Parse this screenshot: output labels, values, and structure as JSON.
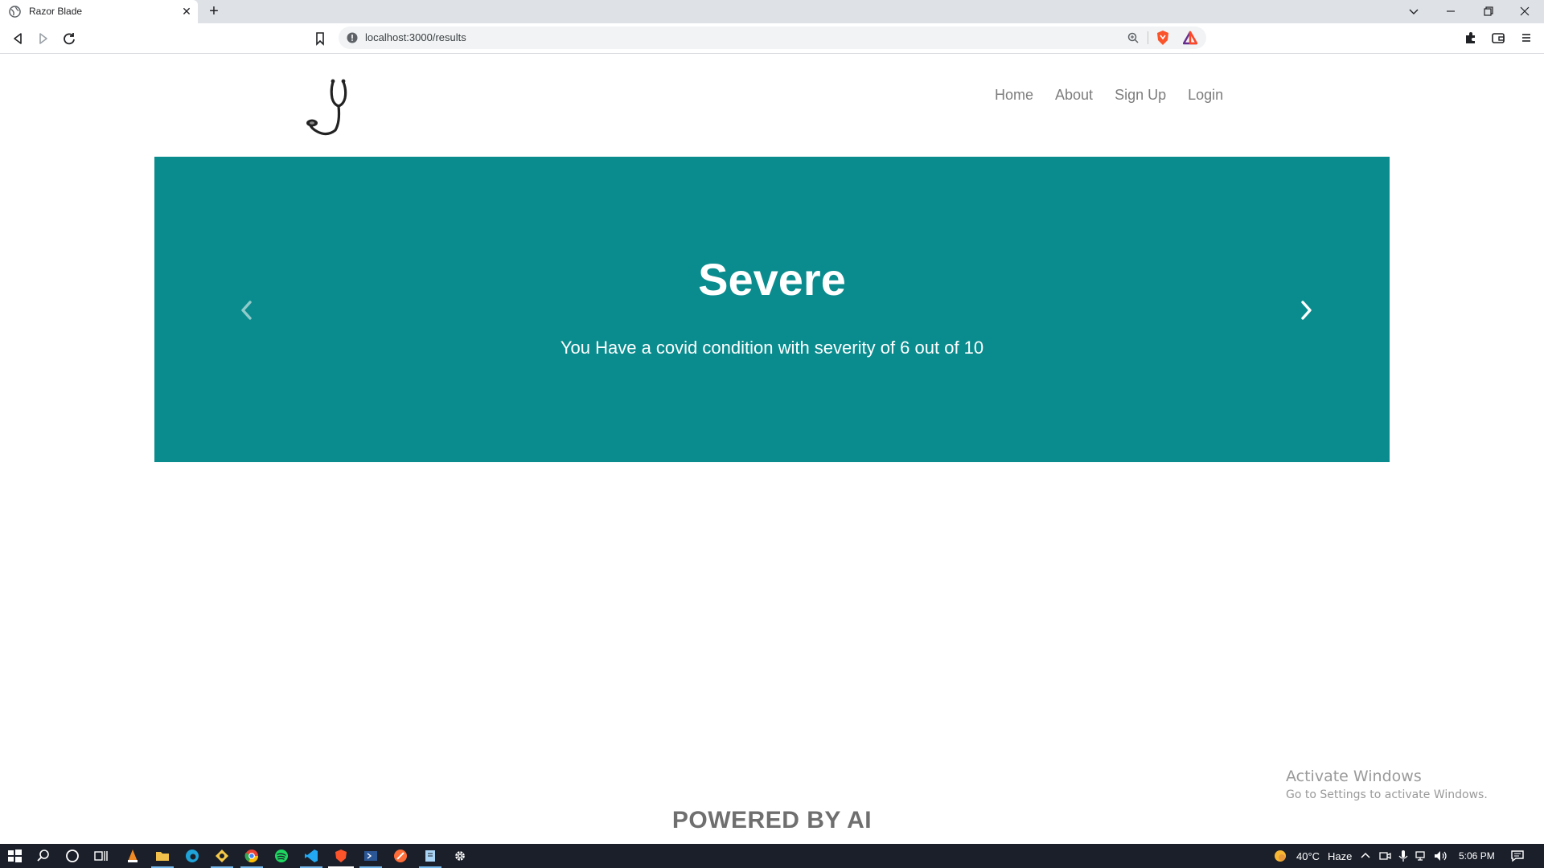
{
  "browser": {
    "tab": {
      "title": "Razor Blade",
      "favicon": "globe-icon"
    },
    "url": "localhost:3000/results"
  },
  "page": {
    "nav": [
      "Home",
      "About",
      "Sign Up",
      "Login"
    ],
    "hero": {
      "title": "Severe",
      "text": "You Have a covid condition with severity of 6 out of 10",
      "background": "#0a8c8e"
    },
    "footer": "POWERED BY AI",
    "watermark": {
      "title": "Activate Windows",
      "subtitle": "Go to Settings to activate Windows."
    }
  },
  "taskbar": {
    "weather": "40°C",
    "condition": "Haze",
    "time": "5:06 PM"
  },
  "colors": {
    "accent": "#0a8c8e",
    "taskbar": "#1b1f2a",
    "nav_text": "#7d7d7d"
  }
}
